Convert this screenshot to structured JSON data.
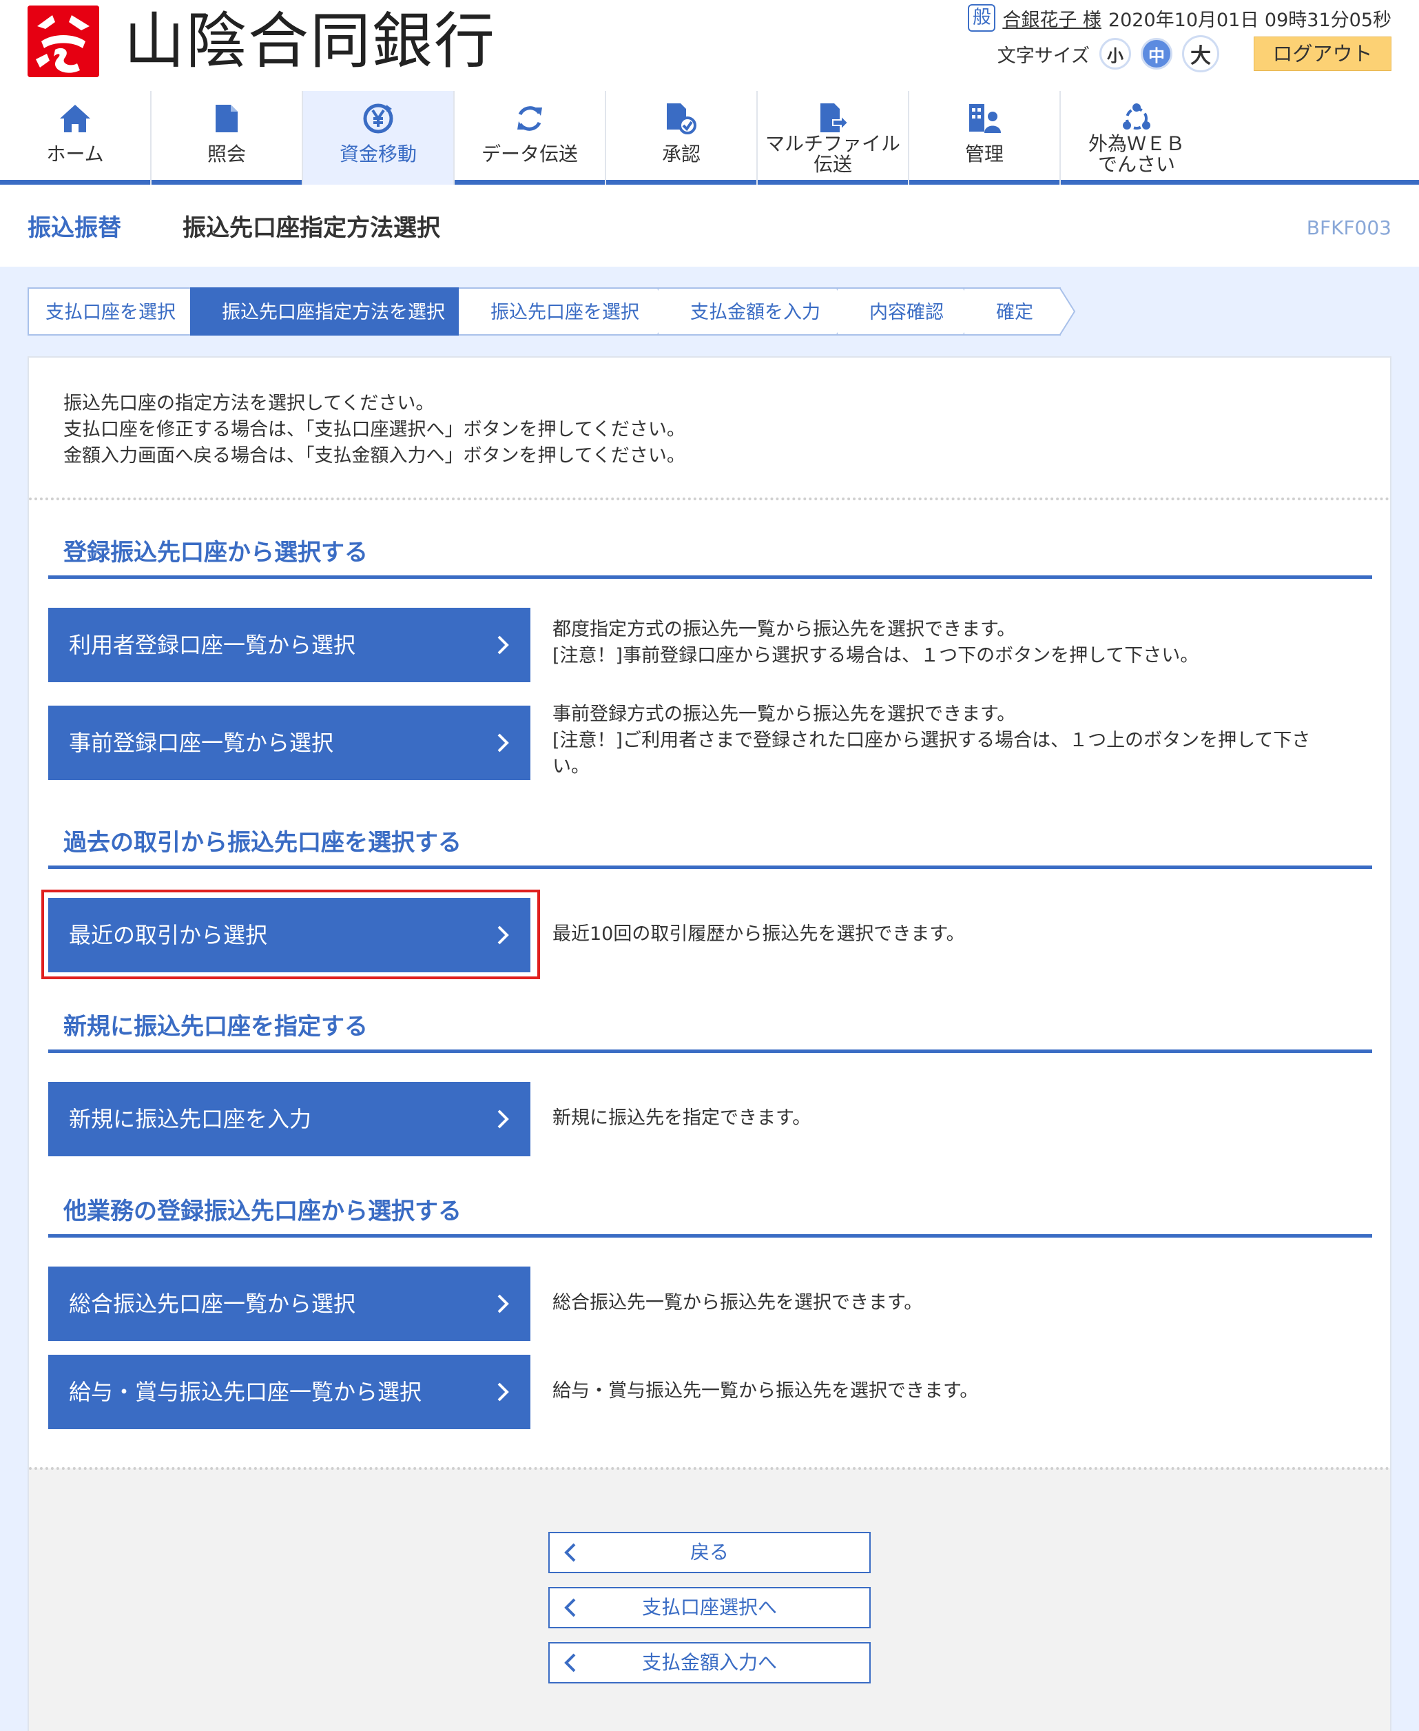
{
  "header": {
    "bank_name": "山陰合同銀行",
    "badge": "般",
    "user_name": "合銀花子 様",
    "datetime": "2020年10月01日 09時31分05秒",
    "font_size_label": "文字サイズ",
    "font_small": "小",
    "font_medium": "中",
    "font_large": "大",
    "logout": "ログアウト"
  },
  "nav": [
    {
      "label": "ホーム",
      "icon": "home-icon"
    },
    {
      "label": "照会",
      "icon": "document-icon"
    },
    {
      "label": "資金移動",
      "icon": "yen-transfer-icon"
    },
    {
      "label": "データ伝送",
      "icon": "refresh-icon"
    },
    {
      "label": "承認",
      "icon": "approve-icon"
    },
    {
      "label": "マルチファイル伝送",
      "line1": "マルチファイル",
      "line2": "伝送",
      "icon": "multi-file-icon"
    },
    {
      "label": "管理",
      "icon": "management-icon"
    },
    {
      "label": "外為ＷＥＢでんさい",
      "line1": "外為ＷＥＢ",
      "line2": "でんさい",
      "icon": "network-icon"
    }
  ],
  "title": {
    "main": "振込振替",
    "sub": "振込先口座指定方法選択",
    "id": "BFKF003"
  },
  "steps": [
    "支払口座を選択",
    "振込先口座指定方法を選択",
    "振込先口座を選択",
    "支払金額を入力",
    "内容確認",
    "確定"
  ],
  "intro": {
    "line1": "振込先口座の指定方法を選択してください。",
    "line2": "支払口座を修正する場合は、「支払口座選択へ」ボタンを押してください。",
    "line3": "金額入力画面へ戻る場合は、「支払金額入力へ」ボタンを押してください。"
  },
  "sections": {
    "registered": {
      "title": "登録振込先口座から選択する",
      "btn1": "利用者登録口座一覧から選択",
      "desc1_line1": "都度指定方式の振込先一覧から振込先を選択できます。",
      "desc1_line2": "[注意！]事前登録口座から選択する場合は、１つ下のボタンを押して下さい。",
      "btn2": "事前登録口座一覧から選択",
      "desc2_line1": "事前登録方式の振込先一覧から振込先を選択できます。",
      "desc2_line2": "[注意！]ご利用者さまで登録された口座から選択する場合は、１つ上のボタンを押して下さ",
      "desc2_line3": "い。"
    },
    "history": {
      "title": "過去の取引から振込先口座を選択する",
      "btn1": "最近の取引から選択",
      "desc1": "最近10回の取引履歴から振込先を選択できます。"
    },
    "new": {
      "title": "新規に振込先口座を指定する",
      "btn1": "新規に振込先口座を入力",
      "desc1": "新規に振込先を指定できます。"
    },
    "other": {
      "title": "他業務の登録振込先口座から選択する",
      "btn1": "総合振込先口座一覧から選択",
      "desc1": "総合振込先一覧から振込先を選択できます。",
      "btn2": "給与・賞与振込先口座一覧から選択",
      "desc2": "給与・賞与振込先一覧から振込先を選択できます。"
    }
  },
  "footer": {
    "back": "戻る",
    "to_payment_account": "支払口座選択へ",
    "to_payment_amount": "支払金額入力へ"
  },
  "colors": {
    "primary": "#3a6cc4",
    "brand_red": "#e60012",
    "logout_bg": "#fcd174",
    "highlight": "#e0201f"
  }
}
